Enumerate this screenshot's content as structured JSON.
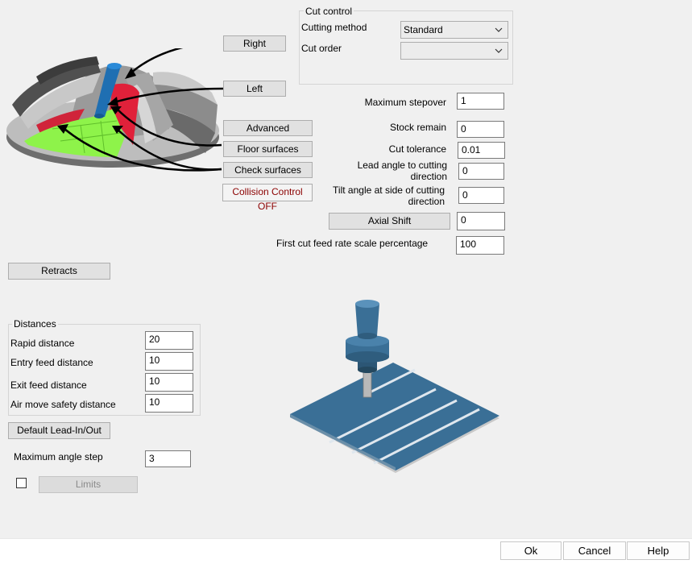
{
  "buttons": {
    "right": "Right",
    "left": "Left",
    "advanced": "Advanced",
    "floor_surfaces": "Floor surfaces",
    "check_surfaces": "Check surfaces",
    "collision_control": "Collision Control OFF",
    "axial_shift": "Axial Shift",
    "retracts": "Retracts",
    "default_lead": "Default Lead-In/Out",
    "limits": "Limits"
  },
  "cut_control": {
    "title": "Cut control",
    "cutting_method_label": "Cutting method",
    "cutting_method_value": "Standard",
    "cut_order_label": "Cut order",
    "cut_order_value": ""
  },
  "params": {
    "max_stepover_label": "Maximum stepover",
    "max_stepover": "1",
    "stock_remain_label": "Stock remain",
    "stock_remain": "0",
    "cut_tolerance_label": "Cut tolerance",
    "cut_tolerance": "0.01",
    "lead_angle_label_1": "Lead angle to cutting",
    "lead_angle_label_2": "direction",
    "lead_angle": "0",
    "tilt_angle_label_1": "Tilt angle at side of cutting",
    "tilt_angle_label_2": "direction",
    "tilt_angle": "0",
    "axial_shift": "0",
    "first_cut_label": "First cut feed rate scale percentage",
    "first_cut": "100"
  },
  "distances": {
    "title": "Distances",
    "rapid_label": "Rapid distance",
    "rapid": "20",
    "entry_label": "Entry feed distance",
    "entry": "10",
    "exit_label": "Exit feed distance",
    "exit": "10",
    "air_label": "Air move safety distance",
    "air": "10"
  },
  "max_angle_step_label": "Maximum angle step",
  "max_angle_step": "3",
  "footer": {
    "ok": "Ok",
    "cancel": "Cancel",
    "help": "Help"
  },
  "icons": {
    "dropdown": "chevron-down-icon"
  }
}
